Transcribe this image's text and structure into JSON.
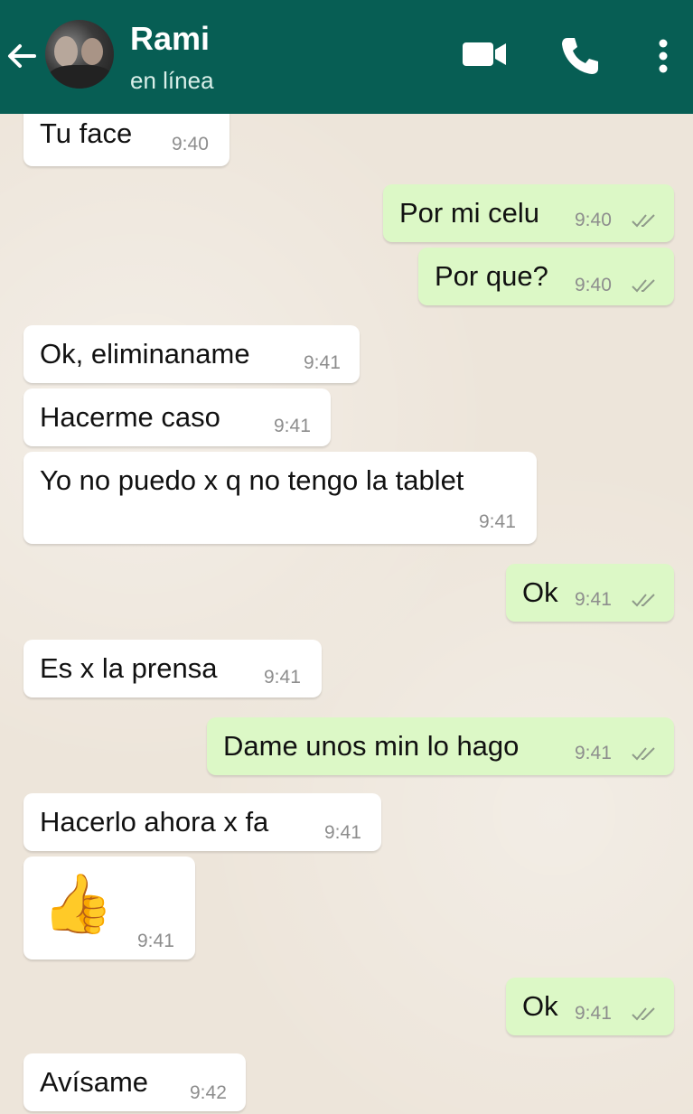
{
  "header": {
    "contact_name": "Rami",
    "status": "en línea",
    "background_color": "#075e54",
    "icons": [
      "back-arrow-icon",
      "video-call-icon",
      "phone-icon",
      "more-vert-icon"
    ]
  },
  "messages": [
    {
      "direction": "in",
      "text": "Tu face",
      "time": "9:40"
    },
    {
      "direction": "out",
      "text": "Por mi celu",
      "time": "9:40",
      "status": "read-ticks"
    },
    {
      "direction": "out",
      "text": "Por que?",
      "time": "9:40",
      "status": "read-ticks"
    },
    {
      "direction": "in",
      "text": "Ok, eliminaname",
      "time": "9:41"
    },
    {
      "direction": "in",
      "text": "Hacerme caso",
      "time": "9:41"
    },
    {
      "direction": "in",
      "text": "Yo no puedo x q no tengo la tablet",
      "time": "9:41"
    },
    {
      "direction": "out",
      "text": "Ok",
      "time": "9:41",
      "status": "read-ticks"
    },
    {
      "direction": "in",
      "text": "Es x la prensa",
      "time": "9:41"
    },
    {
      "direction": "out",
      "text": "Dame unos min lo hago",
      "time": "9:41",
      "status": "read-ticks"
    },
    {
      "direction": "in",
      "text": "Hacerlo ahora x fa",
      "time": "9:41"
    },
    {
      "direction": "in",
      "text": "👍",
      "time": "9:41"
    },
    {
      "direction": "out",
      "text": "Ok",
      "time": "9:41",
      "status": "read-ticks"
    },
    {
      "direction": "in",
      "text": "Avísame",
      "time": "9:42"
    }
  ],
  "colors": {
    "incoming_bubble": "#ffffff",
    "outgoing_bubble": "#dcf8c6",
    "chat_background": "#ede5da"
  }
}
